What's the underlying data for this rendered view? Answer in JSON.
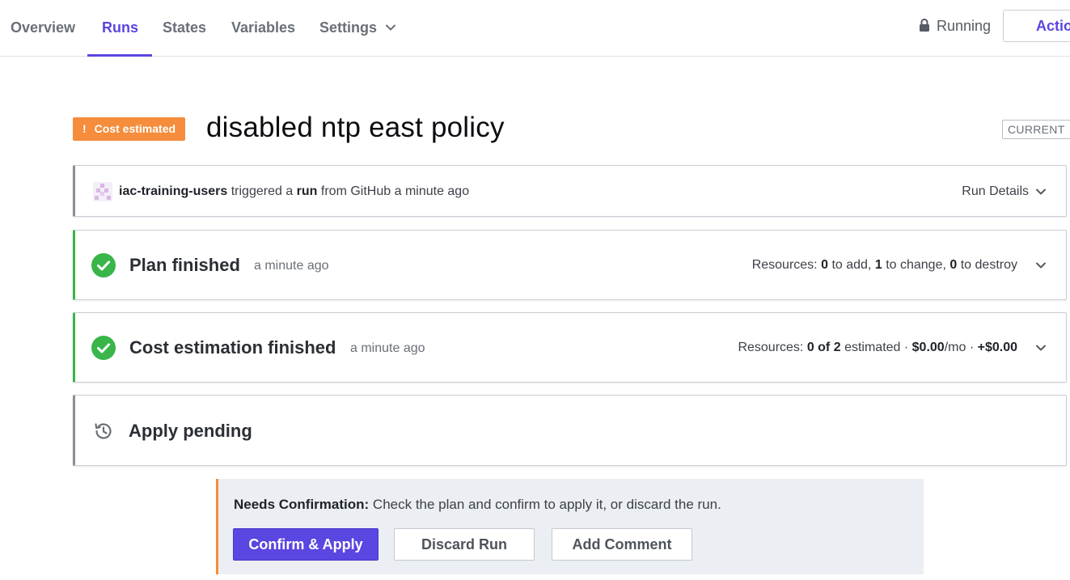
{
  "nav": {
    "tabs": [
      {
        "label": "Overview"
      },
      {
        "label": "Runs",
        "active": true
      },
      {
        "label": "States"
      },
      {
        "label": "Variables"
      },
      {
        "label": "Settings",
        "has_dropdown": true,
        "icon": "chevron-down-icon"
      }
    ],
    "status": {
      "icon": "lock-icon",
      "label": "Running"
    },
    "actions_label": "Actio"
  },
  "run": {
    "badge": {
      "icon": "!",
      "label": "Cost estimated",
      "color": "#f58d3c"
    },
    "title": "disabled ntp east policy",
    "tag": "CURRENT"
  },
  "trigger": {
    "user": "iac-training-users",
    "text_1": "triggered a",
    "run_word": "run",
    "text_2": "from GitHub a minute ago",
    "details_label": "Run Details"
  },
  "plan": {
    "title": "Plan finished",
    "time": "a minute ago",
    "resources_label": "Resources:",
    "add_count": "0",
    "add_label": "to add,",
    "change_count": "1",
    "change_label": "to change,",
    "destroy_count": "0",
    "destroy_label": "to destroy"
  },
  "cost": {
    "title": "Cost estimation finished",
    "time": "a minute ago",
    "resources_label": "Resources:",
    "estimated_count": "0 of 2",
    "estimated_label": "estimated ·",
    "monthly": "$0.00",
    "monthly_unit": "/mo ·",
    "delta": "+$0.00"
  },
  "apply": {
    "title": "Apply pending",
    "icon": "history-icon"
  },
  "confirmation": {
    "heading": "Needs Confirmation:",
    "message": "Check the plan and confirm to apply it, or discard the run.",
    "confirm_label": "Confirm & Apply",
    "discard_label": "Discard Run",
    "comment_label": "Add Comment"
  },
  "colors": {
    "accent": "#5a46e0",
    "success": "#39b54a",
    "warning": "#f58d3c"
  }
}
